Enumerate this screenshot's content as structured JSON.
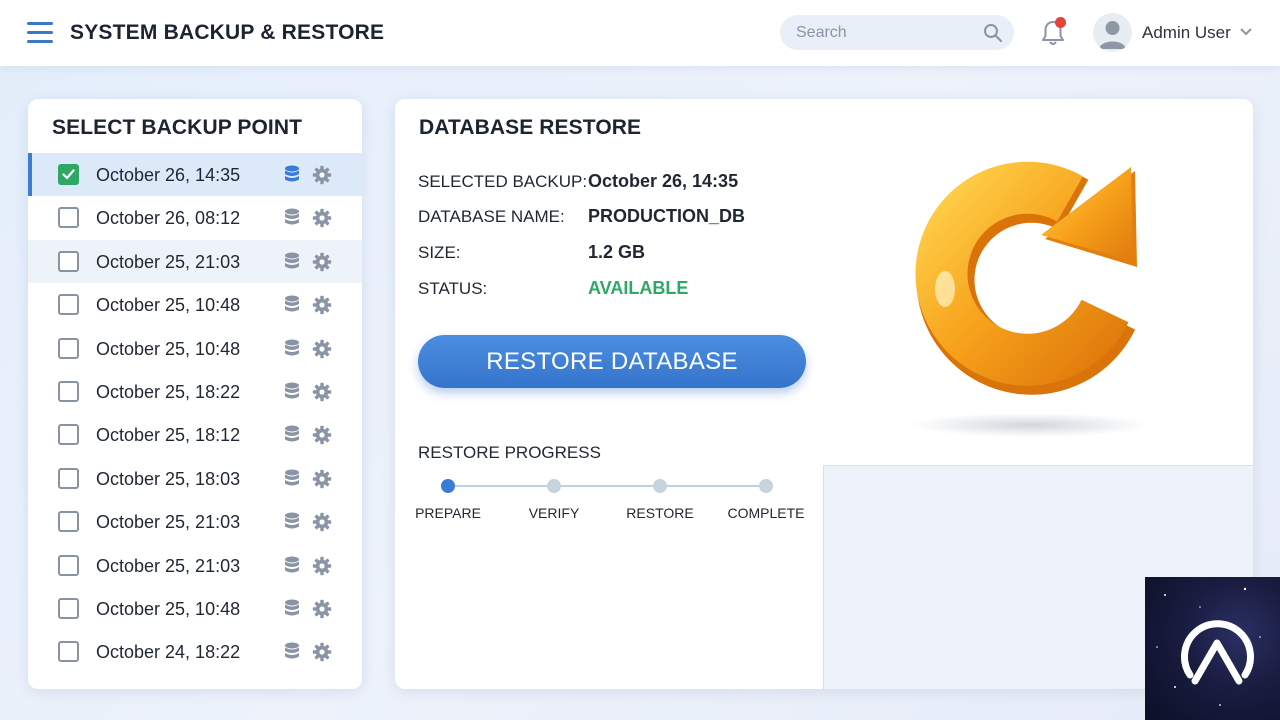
{
  "header": {
    "title": "SYSTEM BACKUP & RESTORE",
    "search_placeholder": "Search",
    "user_name": "Admin User"
  },
  "backup_panel": {
    "title": "SELECT BACKUP POINT",
    "items": [
      {
        "label": "October 26, 14:35",
        "checked": true
      },
      {
        "label": "October 26, 08:12",
        "checked": false
      },
      {
        "label": "October 25, 21:03",
        "checked": false
      },
      {
        "label": "October 25, 10:48",
        "checked": false
      },
      {
        "label": "October 25, 10:48",
        "checked": false
      },
      {
        "label": "October 25, 18:22",
        "checked": false
      },
      {
        "label": "October 25, 18:12",
        "checked": false
      },
      {
        "label": "October 25, 18:03",
        "checked": false
      },
      {
        "label": "October 25, 21:03",
        "checked": false
      },
      {
        "label": "October 25, 21:03",
        "checked": false
      },
      {
        "label": "October 25, 10:48",
        "checked": false
      },
      {
        "label": "October 24, 18:22",
        "checked": false
      }
    ]
  },
  "restore_panel": {
    "title": "DATABASE RESTORE",
    "details": {
      "selected_backup_label": "SELECTED BACKUP:",
      "selected_backup_value": "October 26, 14:35",
      "database_name_label": "DATABASE NAME:",
      "database_name_value": "PRODUCTION_DB",
      "size_label": "SIZE:",
      "size_value": "1.2 GB",
      "status_label": "STATUS:",
      "status_value": "AVAILABLE"
    },
    "restore_button": "RESTORE DATABASE",
    "progress": {
      "title": "RESTORE PROGRESS",
      "steps": [
        "PREPARE",
        "VERIFY",
        "RESTORE",
        "COMPLETE"
      ],
      "active_step": 0
    }
  },
  "colors": {
    "accent": "#3a7bd5",
    "status_available": "#2fa866",
    "notification_dot": "#e8403a",
    "restore_icon": "#f5a623"
  },
  "icons": {
    "menu": "hamburger-icon",
    "search": "search-icon",
    "notifications": "bell-icon",
    "user": "user-avatar-icon",
    "row_database": "database-icon",
    "row_settings": "gear-icon",
    "restore_graphic": "refresh-arrow-icon"
  }
}
